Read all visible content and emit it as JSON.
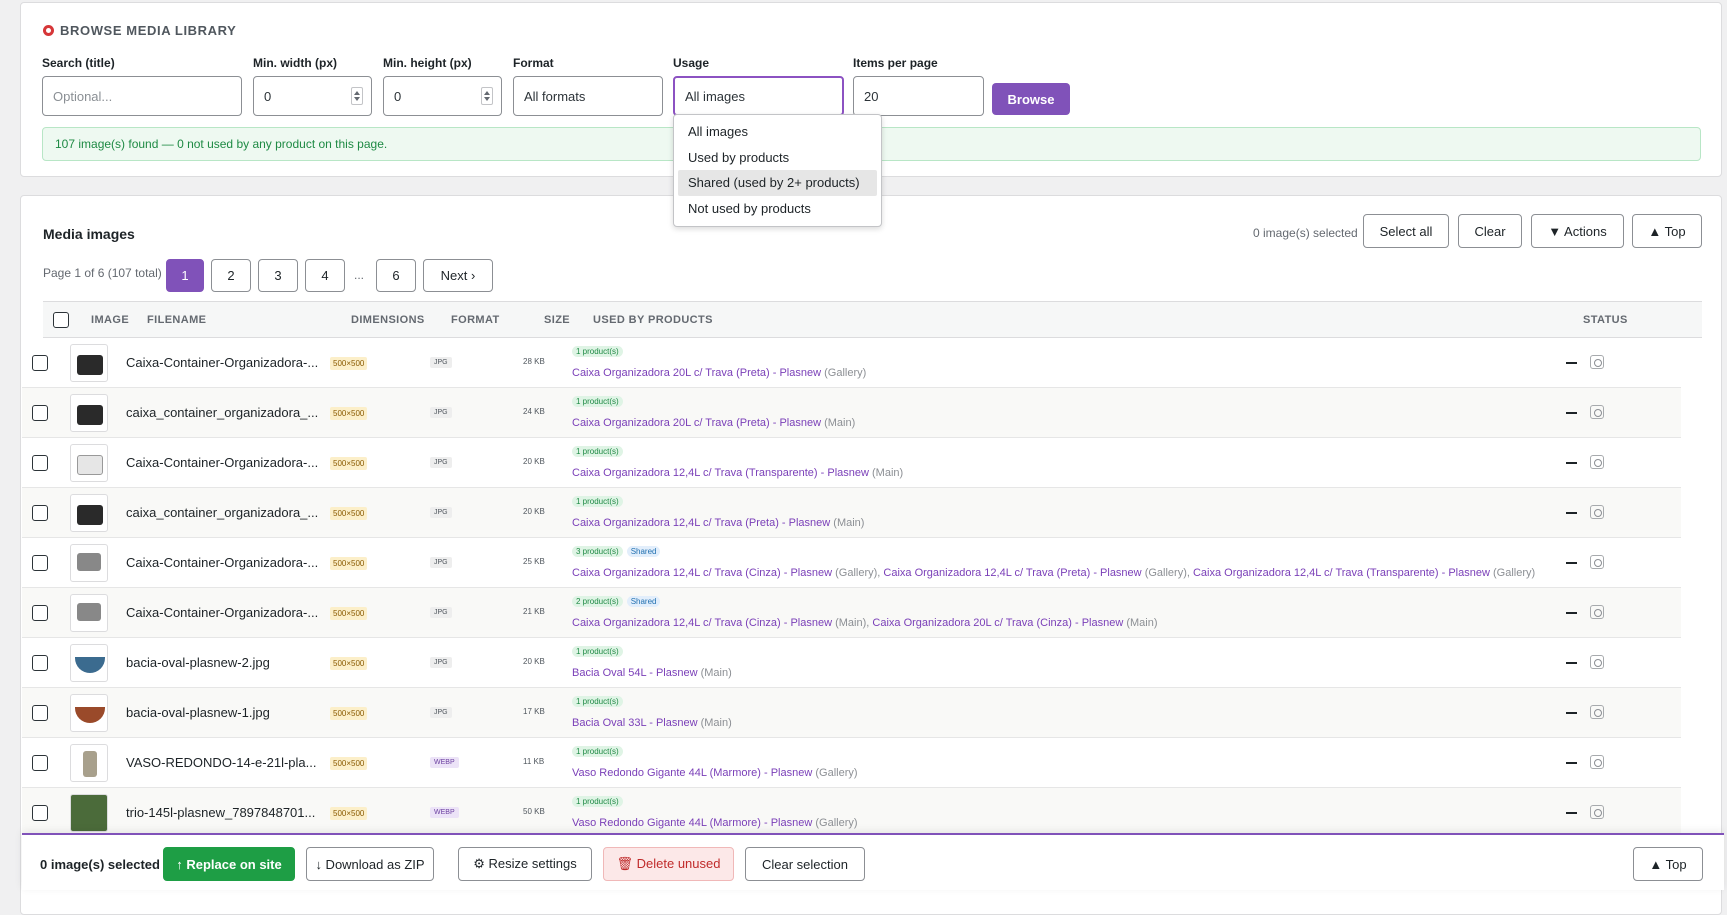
{
  "filter": {
    "title": "BROWSE MEDIA LIBRARY",
    "search_label": "Search (title)",
    "search_placeholder": "Optional...",
    "minw_label": "Min. width (px)",
    "minw_value": "0",
    "minh_label": "Min. height (px)",
    "minh_value": "0",
    "format_label": "Format",
    "format_value": "All formats",
    "usage_label": "Usage",
    "usage_value": "All images",
    "perpage_label": "Items per page",
    "perpage_value": "20",
    "browse_label": "Browse",
    "notice": "107 image(s) found — 0 not used by any product on this page."
  },
  "usage_dropdown": {
    "options": [
      "All images",
      "Used by products",
      "Shared (used by 2+ products)",
      "Not used by products"
    ],
    "highlighted": "Shared (used by 2+ products)"
  },
  "media": {
    "title": "Media images",
    "selected_count": "0 image(s) selected",
    "select_all": "Select all",
    "clear": "Clear",
    "actions": "▼ Actions",
    "top": "▲ Top",
    "page_info": "Page 1 of 6 (107 total)",
    "pages": [
      "1",
      "2",
      "3",
      "4",
      "6"
    ],
    "ellipsis": "...",
    "next": "Next ›",
    "columns": [
      "IMAGE",
      "FILENAME",
      "DIMENSIONS",
      "FORMAT",
      "SIZE",
      "USED BY PRODUCTS",
      "STATUS"
    ],
    "rows": [
      {
        "filename": "Caixa-Container-Organizadora-...",
        "dims": "500×500",
        "format": "JPG",
        "size": "28 KB",
        "count": "1 product(s)",
        "shared": "",
        "prod1": "Caixa Organizadora 20L c/ Trava (Preta) - Plasnew",
        "type1": "(Gallery)",
        "prod2": "",
        "type2": "",
        "prod3": "",
        "type3": "",
        "status": "—",
        "thumb": "dark-box"
      },
      {
        "filename": "caixa_container_organizadora_...",
        "dims": "500×500",
        "format": "JPG",
        "size": "24 KB",
        "count": "1 product(s)",
        "shared": "",
        "prod1": "Caixa Organizadora 20L c/ Trava (Preta) - Plasnew",
        "type1": "(Main)",
        "prod2": "",
        "type2": "",
        "prod3": "",
        "type3": "",
        "status": "—",
        "thumb": "dark-box"
      },
      {
        "filename": "Caixa-Container-Organizadora-...",
        "dims": "500×500",
        "format": "JPG",
        "size": "20 KB",
        "count": "1 product(s)",
        "shared": "",
        "prod1": "Caixa Organizadora 12,4L c/ Trava (Transparente) - Plasnew",
        "type1": "(Main)",
        "prod2": "",
        "type2": "",
        "prod3": "",
        "type3": "",
        "status": "—",
        "thumb": "clear-box"
      },
      {
        "filename": "caixa_container_organizadora_...",
        "dims": "500×500",
        "format": "JPG",
        "size": "20 KB",
        "count": "1 product(s)",
        "shared": "",
        "prod1": "Caixa Organizadora 12,4L c/ Trava (Preta) - Plasnew",
        "type1": "(Main)",
        "prod2": "",
        "type2": "",
        "prod3": "",
        "type3": "",
        "status": "—",
        "thumb": "dark-box"
      },
      {
        "filename": "Caixa-Container-Organizadora-...",
        "dims": "500×500",
        "format": "JPG",
        "size": "25 KB",
        "count": "3 product(s)",
        "shared": "Shared",
        "prod1": "Caixa Organizadora 12,4L c/ Trava (Cinza) - Plasnew",
        "type1": "(Gallery),",
        "prod2": "Caixa Organizadora 12,4L c/ Trava (Preta) - Plasnew",
        "type2": "(Gallery),",
        "prod3": "Caixa Organizadora 12,4L c/ Trava (Transparente) - Plasnew",
        "type3": "(Gallery)",
        "status": "—",
        "thumb": "grey-box"
      },
      {
        "filename": "Caixa-Container-Organizadora-...",
        "dims": "500×500",
        "format": "JPG",
        "size": "21 KB",
        "count": "2 product(s)",
        "shared": "Shared",
        "prod1": "Caixa Organizadora 12,4L c/ Trava (Cinza) - Plasnew",
        "type1": "(Main),",
        "prod2": "Caixa Organizadora 20L c/ Trava (Cinza) - Plasnew",
        "type2": "(Main)",
        "prod3": "",
        "type3": "",
        "status": "—",
        "thumb": "grey-box"
      },
      {
        "filename": "bacia-oval-plasnew-2.jpg",
        "dims": "500×500",
        "format": "JPG",
        "size": "20 KB",
        "count": "1 product(s)",
        "shared": "",
        "prod1": "Bacia Oval 54L - Plasnew",
        "type1": "(Main)",
        "prod2": "",
        "type2": "",
        "prod3": "",
        "type3": "",
        "status": "—",
        "thumb": "blue-basin"
      },
      {
        "filename": "bacia-oval-plasnew-1.jpg",
        "dims": "500×500",
        "format": "JPG",
        "size": "17 KB",
        "count": "1 product(s)",
        "shared": "",
        "prod1": "Bacia Oval 33L - Plasnew",
        "type1": "(Main)",
        "prod2": "",
        "type2": "",
        "prod3": "",
        "type3": "",
        "status": "—",
        "thumb": "brown-basin"
      },
      {
        "filename": "VASO-REDONDO-14-e-21l-pla...",
        "dims": "500×500",
        "format": "WEBP",
        "size": "11 KB",
        "count": "1 product(s)",
        "shared": "",
        "prod1": "Vaso Redondo Gigante 44L (Marmore) - Plasnew",
        "type1": "(Gallery)",
        "prod2": "",
        "type2": "",
        "prod3": "",
        "type3": "",
        "status": "—",
        "thumb": "vase"
      },
      {
        "filename": "trio-145l-plasnew_7897848701...",
        "dims": "500×500",
        "format": "WEBP",
        "size": "50 KB",
        "count": "1 product(s)",
        "shared": "",
        "prod1": "Vaso Redondo Gigante 44L (Marmore) - Plasnew",
        "type1": "(Gallery)",
        "prod2": "",
        "type2": "",
        "prod3": "",
        "type3": "",
        "status": "—",
        "thumb": "plants"
      }
    ]
  },
  "bottom_bar": {
    "count": "0 image(s) selected",
    "replace": "↑ Replace on site",
    "download": "↓ Download as ZIP",
    "resize": "⚙ Resize settings",
    "delete": "🗑 Delete unused",
    "clear": "Clear selection",
    "top": "▲ Top"
  }
}
